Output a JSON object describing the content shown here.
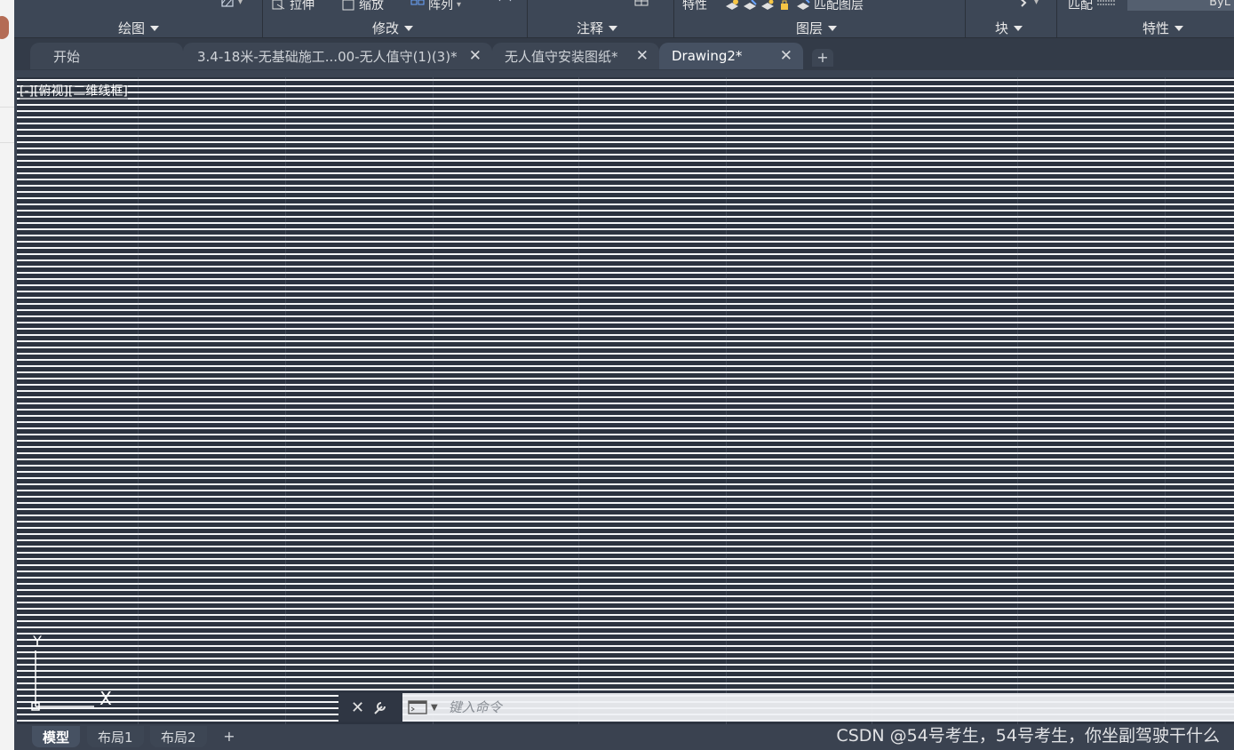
{
  "ribbon": {
    "top_items": {
      "stretch": "拉伸",
      "scale": "缩放",
      "array": "阵列",
      "properties": "特性",
      "match_layer": "匹配图层",
      "match": "匹配",
      "bylayer": "ByL"
    },
    "panels": {
      "draw": "绘图",
      "modify": "修改",
      "annotate": "注释",
      "layers": "图层",
      "block": "块",
      "properties": "特性"
    }
  },
  "tabs": [
    {
      "label": "开始",
      "closable": false
    },
    {
      "label": "3.4-18米-无基础施工...00-无人值守(1)(3)*",
      "closable": true
    },
    {
      "label": "无人值守安装图纸*",
      "closable": true
    },
    {
      "label": "Drawing2*",
      "closable": true,
      "active": true
    }
  ],
  "tab_close_glyph": "✕",
  "tab_add_glyph": "+",
  "viewport": {
    "label": "[-][俯视][二维线框]"
  },
  "ucs": {
    "x_label": "X",
    "y_label": "Y"
  },
  "command": {
    "placeholder": "键入命令",
    "close_glyph": "✕"
  },
  "layout_tabs": [
    {
      "label": "模型",
      "active": true
    },
    {
      "label": "布局1"
    },
    {
      "label": "布局2"
    }
  ],
  "layout_add_glyph": "+",
  "watermark": "CSDN @54号考生，54号考生，你坐副驾驶干什么",
  "colors": {
    "ribbon_bg": "#3d4756",
    "tabbar_bg": "#333b48",
    "active_tab": "#465162",
    "canvas_dark": "#2c3340",
    "canvas_line": "#ffffff"
  }
}
